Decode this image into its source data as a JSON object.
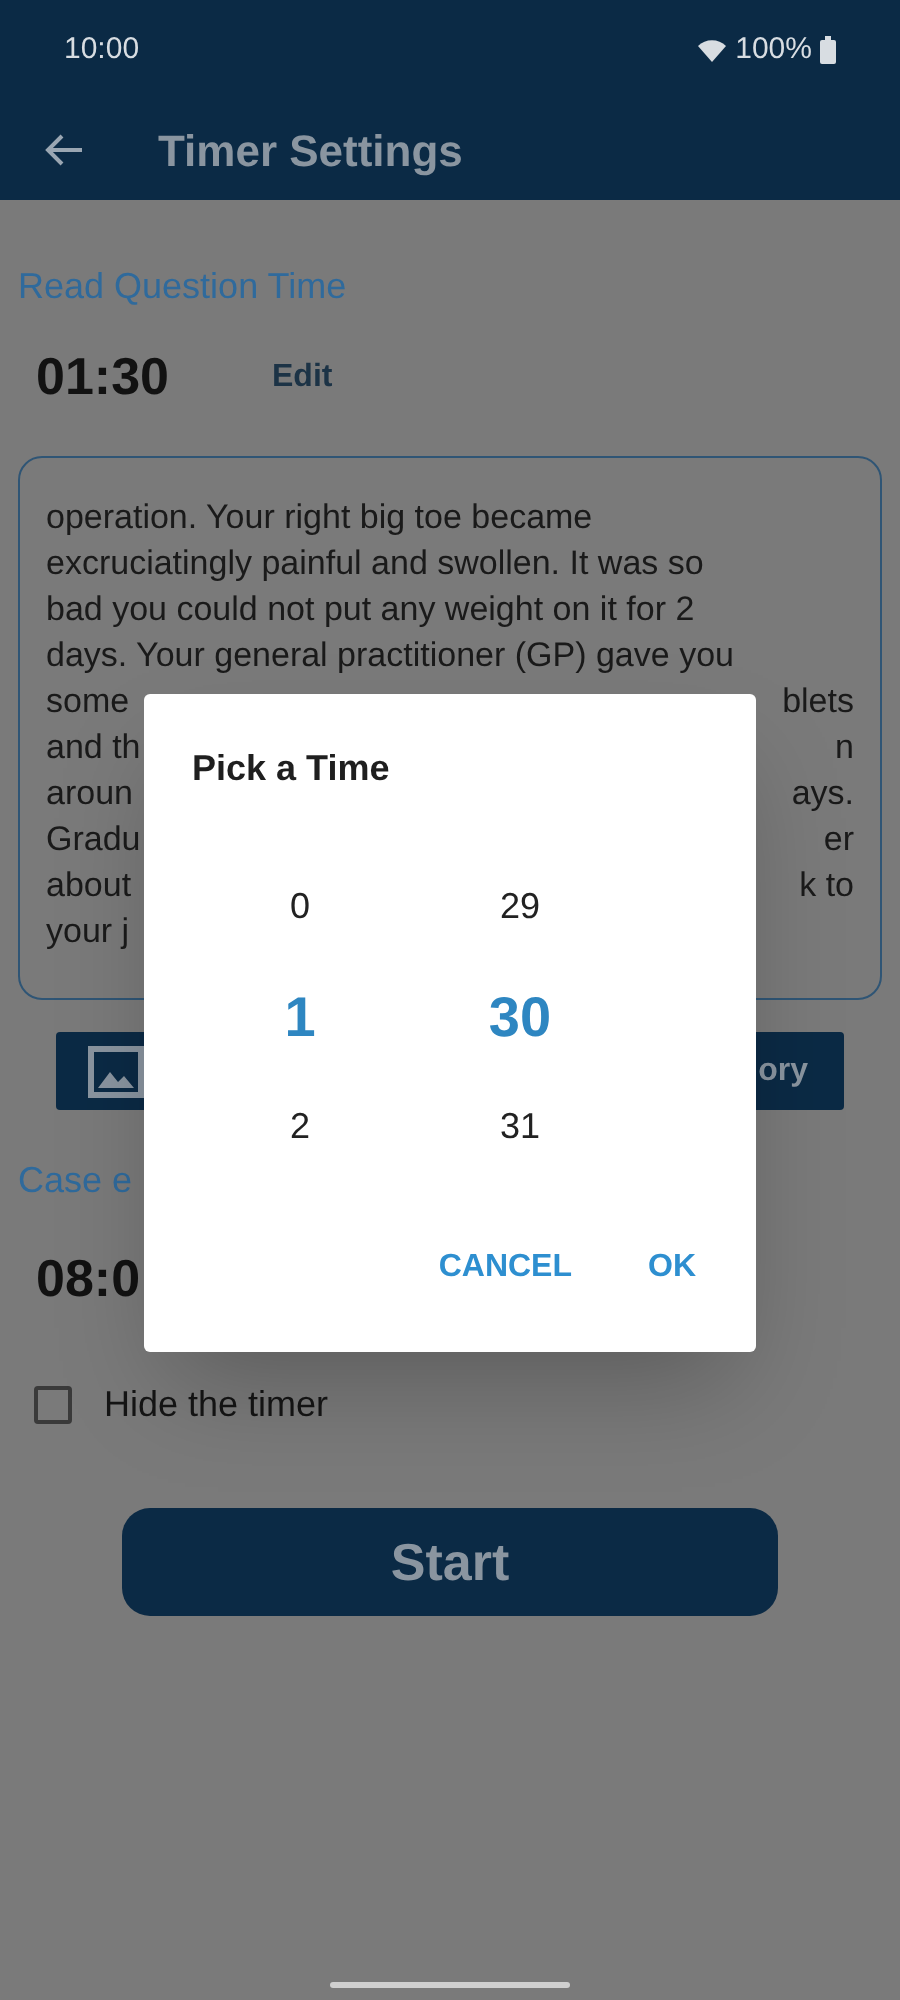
{
  "status_bar": {
    "time": "10:00",
    "battery": "100%"
  },
  "header": {
    "title": "Timer Settings"
  },
  "read_question": {
    "label": "Read Question Time",
    "time": "01:30",
    "edit": "Edit"
  },
  "case_text": {
    "lines": [
      {
        "segments": [
          "operation. Your right big toe became"
        ]
      },
      {
        "segments": [
          "excruciatingly painful and swollen. It was so"
        ]
      },
      {
        "segments": [
          "bad you could not put any weight on it for 2"
        ]
      },
      {
        "segments": [
          "days. Your general practitioner (GP) gave you"
        ]
      },
      {
        "segments": [
          "some",
          "blets"
        ]
      },
      {
        "segments": [
          "and th",
          "n"
        ]
      },
      {
        "segments": [
          "aroun",
          "ays."
        ]
      },
      {
        "segments": [
          "Gradu",
          "er"
        ]
      },
      {
        "segments": [
          "about",
          "k to"
        ]
      },
      {
        "segments": [
          "your j"
        ]
      }
    ]
  },
  "action_buttons": [
    {
      "kind": "icon"
    },
    {
      "kind": "text",
      "label": "ory"
    }
  ],
  "case_end": {
    "label": "Case e",
    "time": "08:0"
  },
  "hide_timer": {
    "label": "Hide the timer",
    "checked": false
  },
  "start_button": {
    "label": "Start"
  },
  "dialog": {
    "title": "Pick a Time",
    "columns": [
      {
        "items": [
          {
            "value": "0",
            "selected": false
          },
          {
            "value": "1",
            "selected": true
          },
          {
            "value": "2",
            "selected": false
          }
        ]
      },
      {
        "items": [
          {
            "value": "29",
            "selected": false
          },
          {
            "value": "30",
            "selected": true
          },
          {
            "value": "31",
            "selected": false
          }
        ]
      }
    ],
    "buttons": [
      "CANCEL",
      "OK"
    ]
  }
}
